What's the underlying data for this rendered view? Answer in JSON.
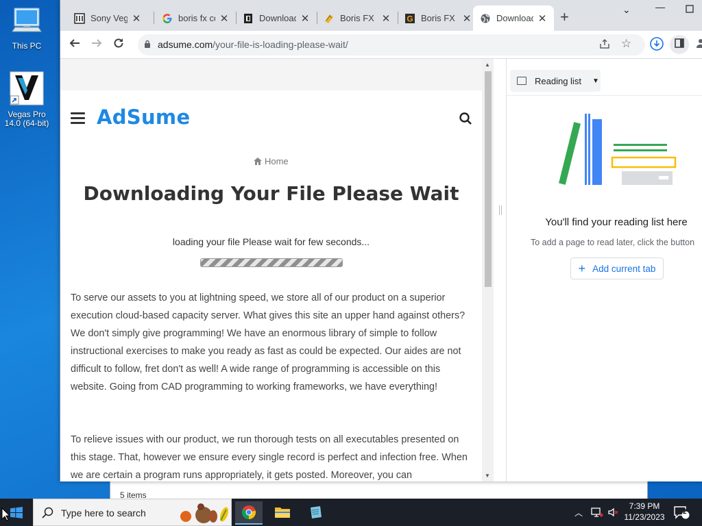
{
  "desktop": {
    "icons": [
      {
        "label": "This PC"
      },
      {
        "label": "Vegas Pro 14.0 (64-bit)"
      }
    ]
  },
  "explorer": {
    "items_count": "5 items"
  },
  "browser": {
    "tabs": [
      {
        "title": "Sony Vegas",
        "icon": "sony-vegas-favicon"
      },
      {
        "title": "boris fx co",
        "icon": "google-icon"
      },
      {
        "title": "Download",
        "icon": "download-site-favicon"
      },
      {
        "title": "Boris FX S",
        "icon": "boris-fx-favicon"
      },
      {
        "title": "Boris FX C",
        "icon": "gamepedia-favicon"
      },
      {
        "title": "Download",
        "icon": "globe-icon",
        "active": true
      }
    ],
    "url_host": "adsume.com",
    "url_path": "/your-file-is-loading-please-wait/"
  },
  "site": {
    "logo": "AdSume",
    "breadcrumb": "Home",
    "title": "Downloading Your File Please Wait",
    "loading_text": "loading your file Please wait for few seconds...",
    "progress": 1.0,
    "paragraphs": [
      "To serve our assets to you at lightning speed, we store all of our product on a superior execution cloud-based capacity server. What gives this site an upper hand against others? We don't simply give programming! We have an enormous library of simple to follow instructional exercises to make you ready as fast as could be expected. Our aides are not difficult to follow, fret don't as well! A wide range of programming is accessible on this website. Going from CAD programming to working frameworks, we have everything!",
      "To relieve issues with our product, we run thorough tests on all executables presented on this stage. That, however we ensure every single record is perfect and infection free. When we are certain a program runs appropriately, it gets posted. Moreover, you can"
    ]
  },
  "side_panel": {
    "selector_label": "Reading list",
    "empty_title": "You'll find your reading list here",
    "empty_desc": "To add a page to read later, click the button",
    "add_button": "Add current tab"
  },
  "taskbar": {
    "search_placeholder": "Type here to search",
    "time": "7:39 PM",
    "date": "11/23/2023",
    "notifications": "2"
  },
  "colors": {
    "brand": "#1e88e5",
    "link": "#1a73e8"
  }
}
